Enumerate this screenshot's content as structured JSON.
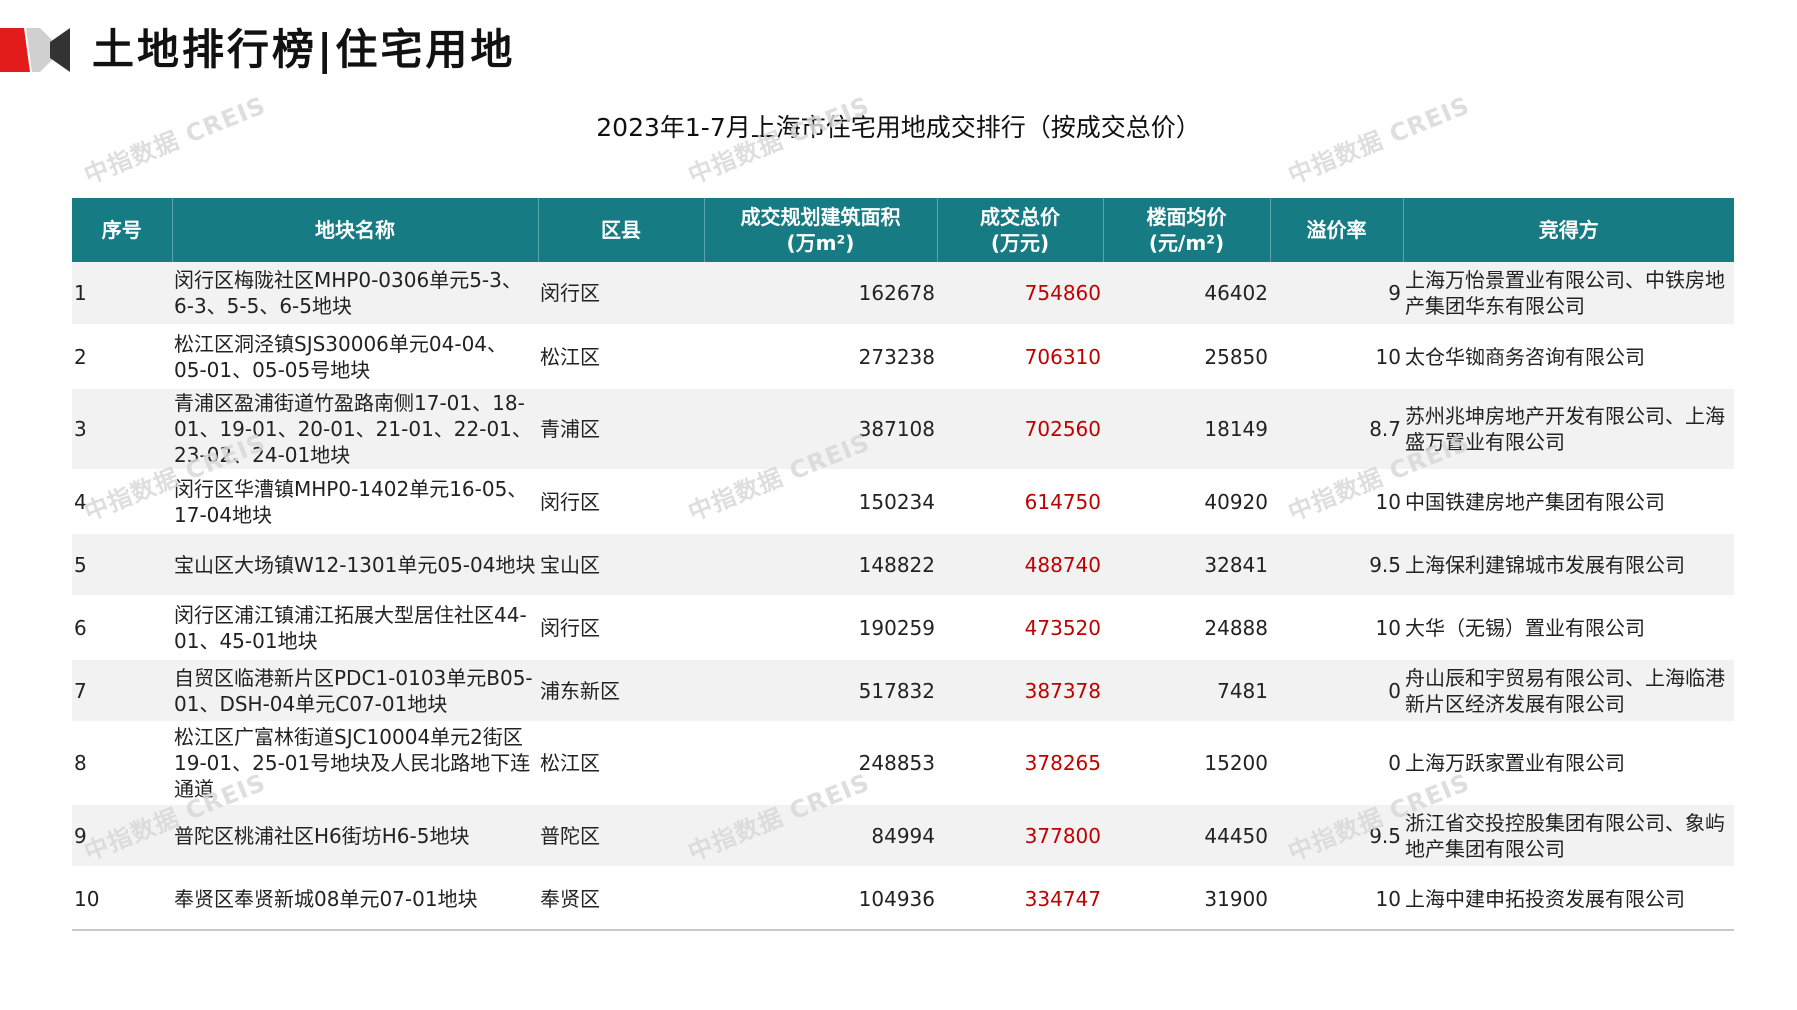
{
  "header": {
    "title": "土地排行榜|住宅用地"
  },
  "table_title": "2023年1-7月上海市住宅用地成交排行（按成交总价）",
  "watermark_text": "中指数据 CREIS",
  "columns": [
    {
      "line1": "序号",
      "line2": ""
    },
    {
      "line1": "地块名称",
      "line2": ""
    },
    {
      "line1": "区县",
      "line2": ""
    },
    {
      "line1": "成交规划建筑面积",
      "line2": "(万m²)"
    },
    {
      "line1": "成交总价",
      "line2": "(万元)"
    },
    {
      "line1": "楼面均价",
      "line2": "(元/m²)"
    },
    {
      "line1": "溢价率",
      "line2": ""
    },
    {
      "line1": "竞得方",
      "line2": ""
    }
  ],
  "rows": [
    {
      "no": "1",
      "name": "闵行区梅陇社区MHP0-0306单元5-3、6-3、5-5、6-5地块",
      "district": "闵行区",
      "area": "162678",
      "total": "754860",
      "unit_price": "46402",
      "premium": "9",
      "winner": "上海万怡景置业有限公司、中铁房地产集团华东有限公司"
    },
    {
      "no": "2",
      "name": "松江区洞泾镇SJS30006单元04-04、05-01、05-05号地块",
      "district": "松江区",
      "area": "273238",
      "total": "706310",
      "unit_price": "25850",
      "premium": "10",
      "winner": "太仓华铷商务咨询有限公司"
    },
    {
      "no": "3",
      "name": "青浦区盈浦街道竹盈路南侧17-01、18-01、19-01、20-01、21-01、22-01、23-02、24-01地块",
      "district": "青浦区",
      "area": "387108",
      "total": "702560",
      "unit_price": "18149",
      "premium": "8.7",
      "winner": "苏州兆坤房地产开发有限公司、上海盛万置业有限公司"
    },
    {
      "no": "4",
      "name": "闵行区华漕镇MHP0-1402单元16-05、17-04地块",
      "district": "闵行区",
      "area": "150234",
      "total": "614750",
      "unit_price": "40920",
      "premium": "10",
      "winner": "中国铁建房地产集团有限公司"
    },
    {
      "no": "5",
      "name": "宝山区大场镇W12-1301单元05-04地块",
      "district": "宝山区",
      "area": "148822",
      "total": "488740",
      "unit_price": "32841",
      "premium": "9.5",
      "winner": "上海保利建锦城市发展有限公司"
    },
    {
      "no": "6",
      "name": "闵行区浦江镇浦江拓展大型居住社区44-01、45-01地块",
      "district": "闵行区",
      "area": "190259",
      "total": "473520",
      "unit_price": "24888",
      "premium": "10",
      "winner": "大华（无锡）置业有限公司"
    },
    {
      "no": "7",
      "name": "自贸区临港新片区PDC1-0103单元B05-01、DSH-04单元C07-01地块",
      "district": "浦东新区",
      "area": "517832",
      "total": "387378",
      "unit_price": "7481",
      "premium": "0",
      "winner": "舟山辰和宇贸易有限公司、上海临港新片区经济发展有限公司"
    },
    {
      "no": "8",
      "name": "松江区广富林街道SJC10004单元2街区19-01、25-01号地块及人民北路地下连通道",
      "district": "松江区",
      "area": "248853",
      "total": "378265",
      "unit_price": "15200",
      "premium": "0",
      "winner": "上海万跃家置业有限公司"
    },
    {
      "no": "9",
      "name": "普陀区桃浦社区H6街坊H6-5地块",
      "district": "普陀区",
      "area": "84994",
      "total": "377800",
      "unit_price": "44450",
      "premium": "9.5",
      "winner": "浙江省交投控股集团有限公司、象屿地产集团有限公司"
    },
    {
      "no": "10",
      "name": "奉贤区奉贤新城08单元07-01地块",
      "district": "奉贤区",
      "area": "104936",
      "total": "334747",
      "unit_price": "31900",
      "premium": "10",
      "winner": "上海中建申拓投资发展有限公司"
    }
  ]
}
